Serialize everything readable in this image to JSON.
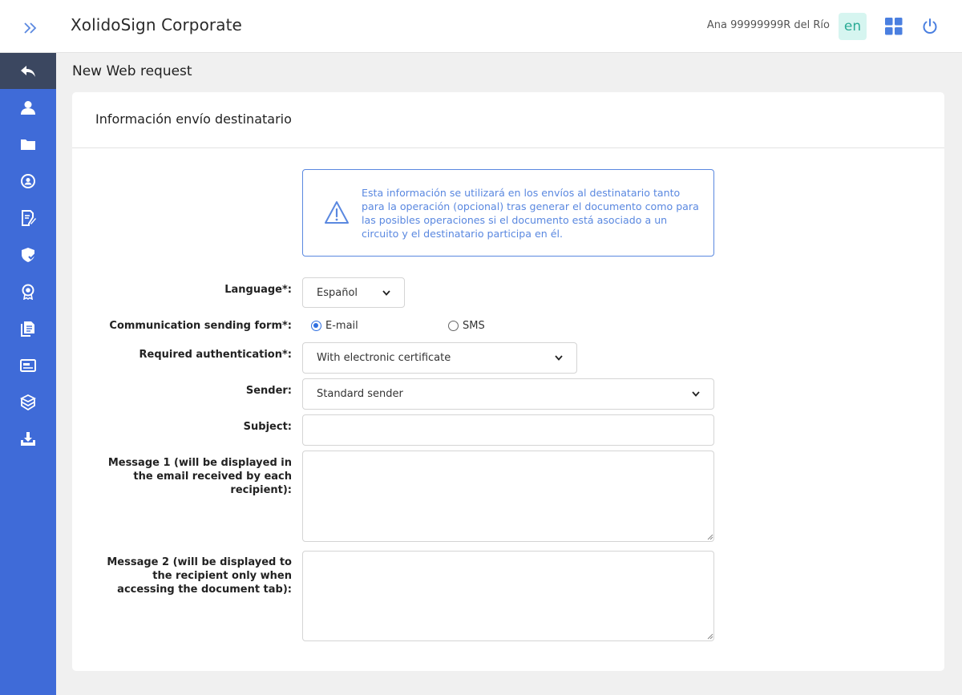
{
  "header": {
    "title": "XolidoSign Corporate",
    "user": "Ana 99999999R del Río",
    "language": "en",
    "expand_icon": "double-chevron-right-icon",
    "apps_icon": "grid-icon",
    "power_icon": "power-icon"
  },
  "sidebar": {
    "items": [
      {
        "icon": "back-arrow-icon"
      },
      {
        "icon": "user-icon"
      },
      {
        "icon": "folder-icon"
      },
      {
        "icon": "user-circle-icon"
      },
      {
        "icon": "document-edit-icon"
      },
      {
        "icon": "shield-check-icon"
      },
      {
        "icon": "certificate-badge-icon"
      },
      {
        "icon": "documents-icon"
      },
      {
        "icon": "card-icon"
      },
      {
        "icon": "box-icon"
      },
      {
        "icon": "download-tray-icon"
      }
    ]
  },
  "page": {
    "heading": "New Web request"
  },
  "card": {
    "title": "Información envío destinatario",
    "info": "Esta información se utilizará en los envíos al destinatario tanto para la operación (opcional) tras generar el documento como para las posibles operaciones si el documento está asociado a un circuito y el destinatario participa en él."
  },
  "form": {
    "language_label": "Language*:",
    "language_value": "Español",
    "sending_form_label": "Communication sending form*:",
    "sending_options": [
      "E-mail",
      "SMS"
    ],
    "sending_selected": "E-mail",
    "auth_label": "Required authentication*:",
    "auth_value": "With electronic certificate",
    "sender_label": "Sender:",
    "sender_value": "Standard sender",
    "subject_label": "Subject:",
    "subject_value": "",
    "message1_label": "Message 1 (will be displayed in the email received by each recipient):",
    "message1_value": "",
    "message2_label": "Message 2 (will be displayed to the recipient only when accessing the document tab):",
    "message2_value": ""
  },
  "colors": {
    "sidebar": "#3f6bd8",
    "sidebar_active": "#3b4760",
    "accent": "#5a88e0",
    "badge_bg": "#d6f5f0",
    "badge_text": "#2aab95"
  }
}
